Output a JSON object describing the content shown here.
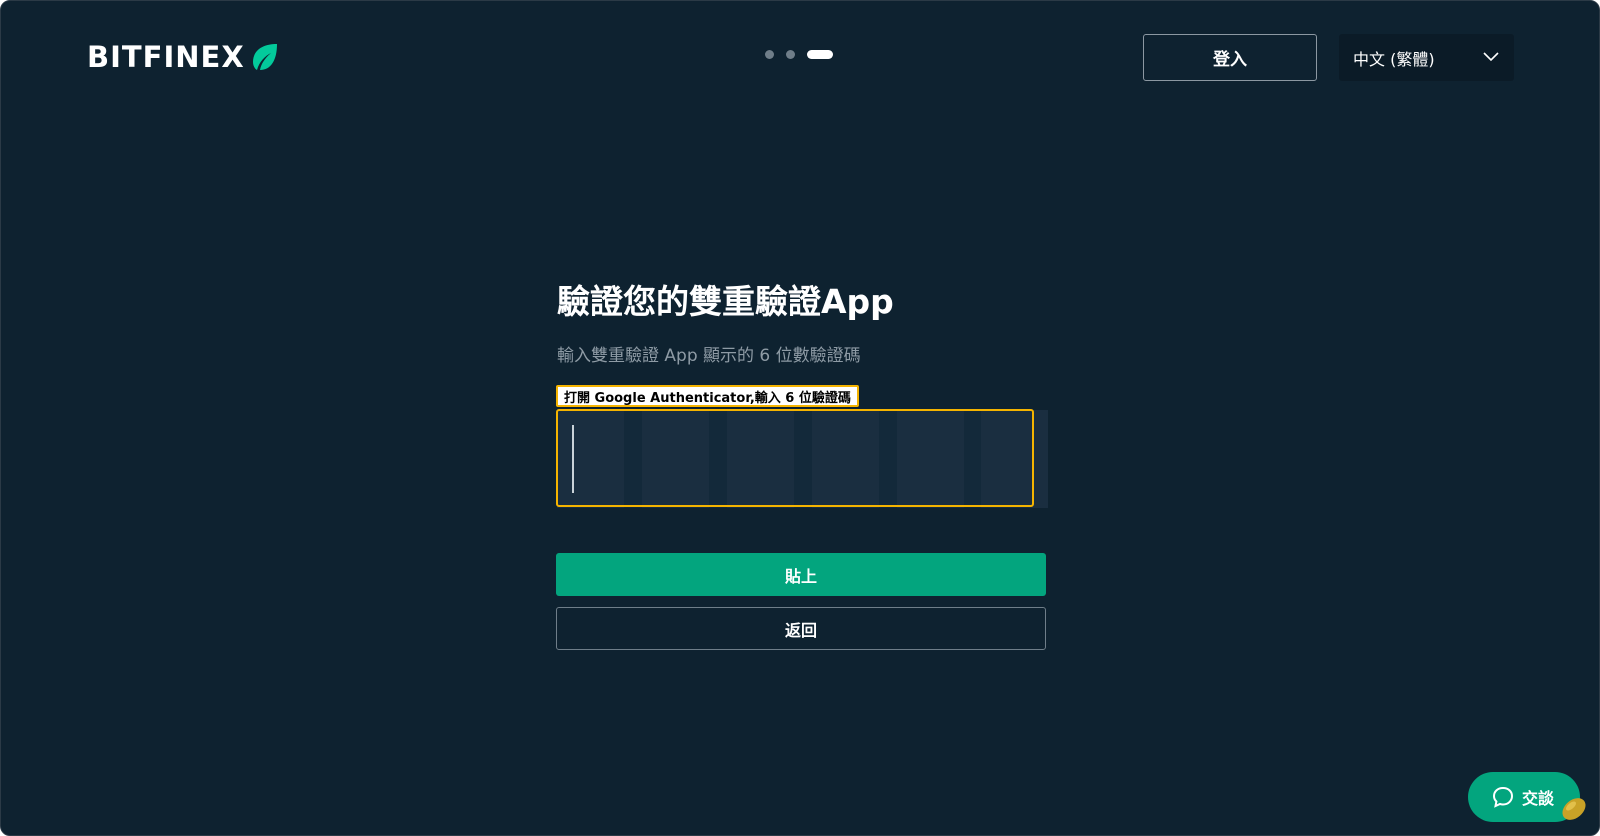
{
  "header": {
    "logo_text": "BITFINEX",
    "login_label": "登入",
    "language": "中文 (繁體)",
    "steps": {
      "total": 3,
      "active": 3
    }
  },
  "main": {
    "title": "驗證您的雙重驗證App",
    "subtitle": "輸入雙重驗證 App 顯示的 6 位數驗證碼",
    "tooltip": "打開 Google Authenticator,輸入 6 位驗證碼",
    "otp": {
      "length": 6,
      "value": ""
    },
    "paste_label": "貼上",
    "back_label": "返回"
  },
  "chat": {
    "label": "交談"
  },
  "colors": {
    "background": "#0e2230",
    "accent": "#03a57e",
    "highlight": "#f5b400"
  }
}
